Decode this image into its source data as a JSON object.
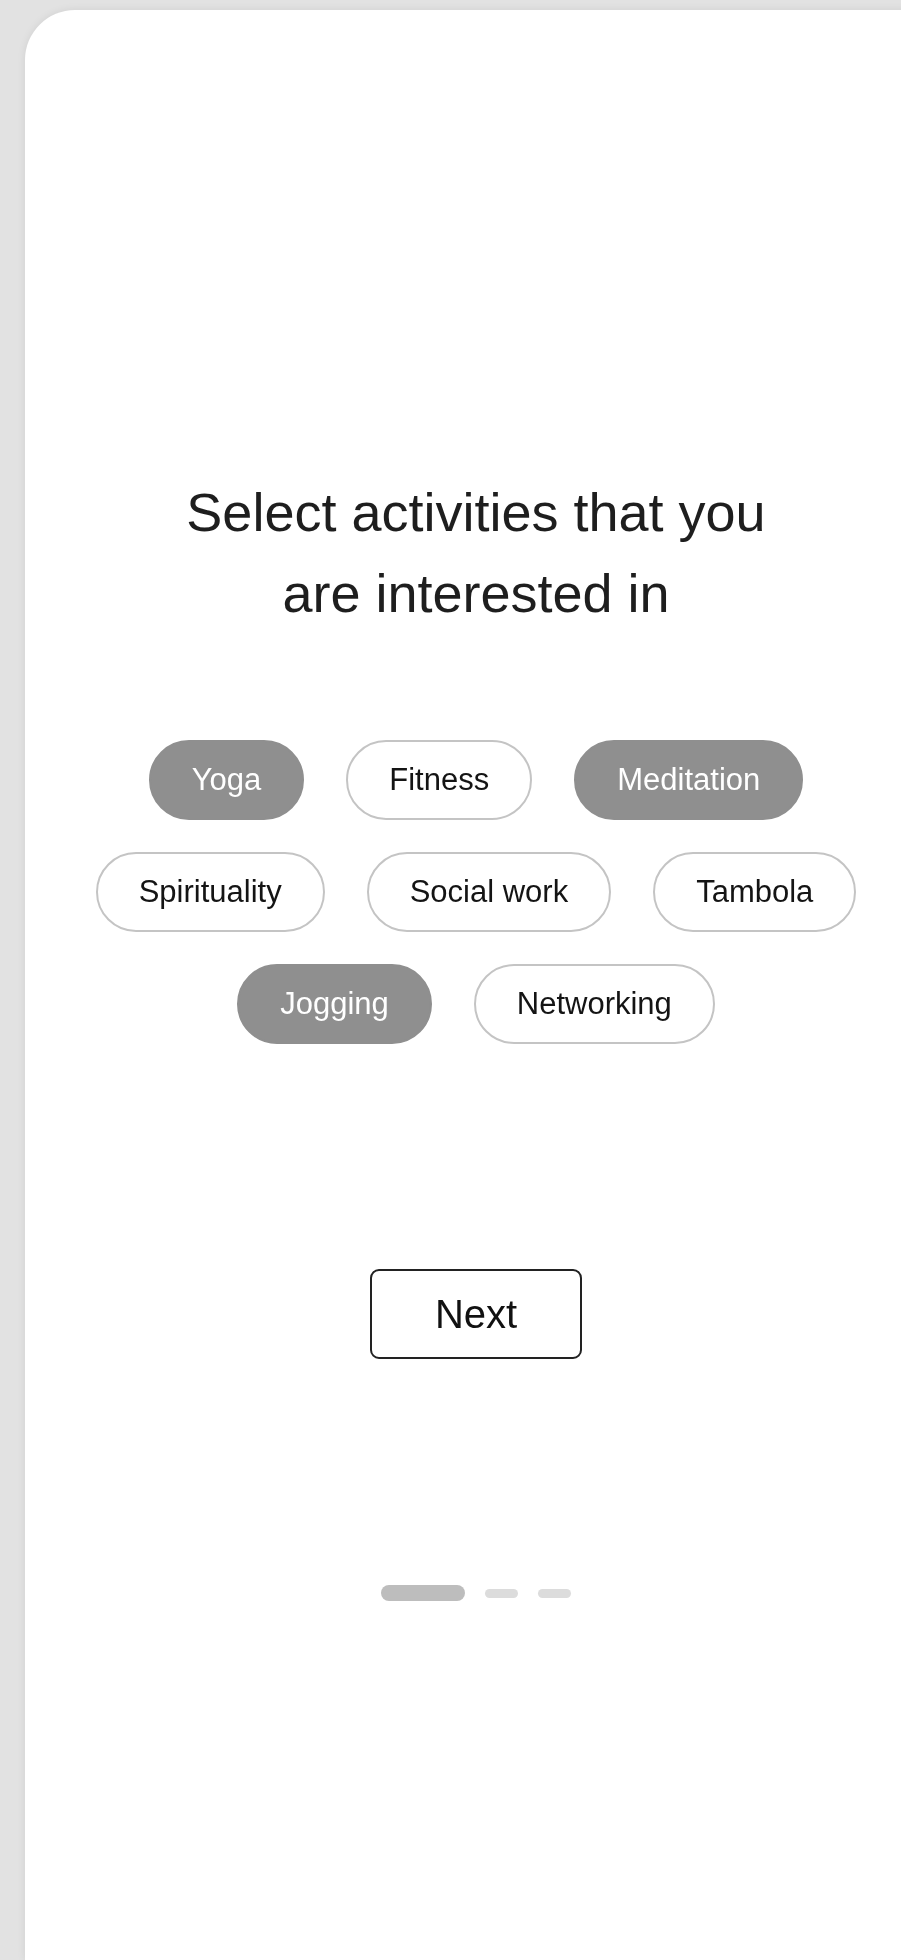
{
  "title": "Select activities that you are interested in",
  "activity_rows": [
    [
      {
        "label": "Yoga",
        "selected": true
      },
      {
        "label": "Fitness",
        "selected": false
      },
      {
        "label": "Meditation",
        "selected": true
      }
    ],
    [
      {
        "label": "Spirituality",
        "selected": false
      },
      {
        "label": "Social work",
        "selected": false
      },
      {
        "label": "Tambola",
        "selected": false
      }
    ],
    [
      {
        "label": "Jogging",
        "selected": true
      },
      {
        "label": "Networking",
        "selected": false
      }
    ]
  ],
  "next_button": {
    "label": "Next"
  },
  "pager": [
    {
      "selected": true
    },
    {
      "selected": false
    },
    {
      "selected": false
    }
  ]
}
